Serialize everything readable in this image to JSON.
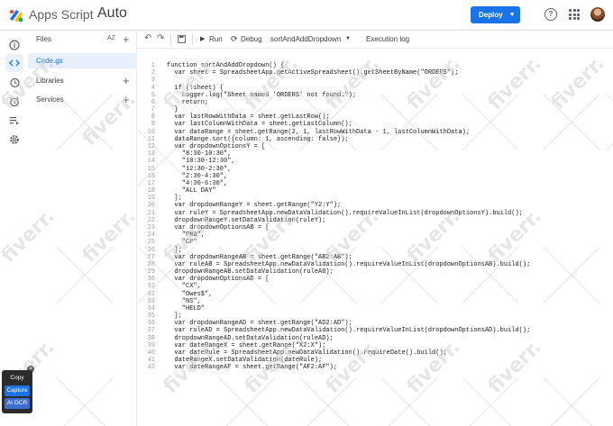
{
  "app": {
    "name": "Apps Script",
    "project": "Auto",
    "deploy_label": "Deploy",
    "colors": {
      "accent": "#1a73e8"
    }
  },
  "rail": {
    "icons": [
      "info-icon",
      "code-icon",
      "history-icon",
      "alarm-icon",
      "executions-icon",
      "settings-icon"
    ]
  },
  "files": {
    "header": "Files",
    "sort_label": "AZ",
    "items": [
      "Code.gs"
    ],
    "libraries": "Libraries",
    "services": "Services"
  },
  "toolbar": {
    "run": "Run",
    "debug": "Debug",
    "function": "sortAndAddDropdown",
    "exec_log": "Execution log"
  },
  "code": {
    "lines": [
      {
        "n": "1",
        "t": "function sortAndAddDropdown() {"
      },
      {
        "n": "2",
        "t": "  var sheet = SpreadsheetApp.getActiveSpreadsheet().getSheetByName(\"ORDERS\");"
      },
      {
        "n": "3",
        "t": ""
      },
      {
        "n": "4",
        "t": "  if (!sheet) {"
      },
      {
        "n": "5",
        "t": "    Logger.log(\"Sheet named 'ORDERS' not found.\");"
      },
      {
        "n": "6",
        "t": "    return;"
      },
      {
        "n": "7",
        "t": "  }"
      },
      {
        "n": "8",
        "t": "  var lastRowWithData = sheet.getLastRow();"
      },
      {
        "n": "9",
        "t": "  var lastColumnWithData = sheet.getLastColumn();"
      },
      {
        "n": "10",
        "t": "  var dataRange = sheet.getRange(2, 1, lastRowWithData - 1, lastColumnWithData);"
      },
      {
        "n": "11",
        "t": "  dataRange.sort({column: 1, ascending: false});"
      },
      {
        "n": "12",
        "t": "  var dropdownOptionsY = ["
      },
      {
        "n": "13",
        "t": "    \"8:30-10:30\","
      },
      {
        "n": "14",
        "t": "    \"10:30-12:30\","
      },
      {
        "n": "15",
        "t": "    \"12:30-2:30\","
      },
      {
        "n": "16",
        "t": "    \"2:30-4:30\","
      },
      {
        "n": "17",
        "t": "    \"4:30-6:30\","
      },
      {
        "n": "18",
        "t": "    \"ALL DAY\""
      },
      {
        "n": "19",
        "t": "  ];"
      },
      {
        "n": "20",
        "t": "  var dropdownRangeY = sheet.getRange(\"Y2:Y\");"
      },
      {
        "n": "21",
        "t": "  var ruleY = SpreadsheetApp.newDataValidation().requireValueInList(dropdownOptionsY).build();"
      },
      {
        "n": "22",
        "t": "  dropdownRangeY.setDataValidation(ruleY);"
      },
      {
        "n": "23",
        "t": "  var dropdownOptionsAB = ["
      },
      {
        "n": "24",
        "t": "    \"PNO\","
      },
      {
        "n": "25",
        "t": "    \"CP\""
      },
      {
        "n": "26",
        "t": "  ];"
      },
      {
        "n": "27",
        "t": "  var dropdownRangeAB = sheet.getRange(\"AB2:AB\");"
      },
      {
        "n": "28",
        "t": "  var ruleAB = SpreadsheetApp.newDataValidation().requireValueInList(dropdownOptionsAB).build();"
      },
      {
        "n": "29",
        "t": "  dropdownRangeAB.setDataValidation(ruleAB);"
      },
      {
        "n": "30",
        "t": "  var dropdownOptionsAD = ["
      },
      {
        "n": "31",
        "t": "    \"CX\","
      },
      {
        "n": "32",
        "t": "    \"Owes$\","
      },
      {
        "n": "33",
        "t": "    \"NS\","
      },
      {
        "n": "34",
        "t": "    \"HELD\""
      },
      {
        "n": "35",
        "t": "  ];"
      },
      {
        "n": "36",
        "t": "  var dropdownRangeAD = sheet.getRange(\"AD2:AD\");"
      },
      {
        "n": "37",
        "t": "  var ruleAD = SpreadsheetApp.newDataValidation().requireValueInList(dropdownOptionsAD).build();"
      },
      {
        "n": "38",
        "t": "  dropdownRangeAD.setDataValidation(ruleAD);"
      },
      {
        "n": "39",
        "t": "  var dateRangeX = sheet.getRange(\"X2:X\");"
      },
      {
        "n": "40",
        "t": "  var dateRule = SpreadsheetApp.newDataValidation().requireDate().build();"
      },
      {
        "n": "41",
        "t": "  dateRangeX.setDataValidation(dateRule);"
      },
      {
        "n": "42",
        "t": "  var dateRangeAF = sheet.getRange(\"AF2:AF\");"
      }
    ]
  },
  "watermark": "fiverr.",
  "widget": {
    "copy": "Copy",
    "capture": "Capture",
    "ocr": "AI OCR"
  }
}
